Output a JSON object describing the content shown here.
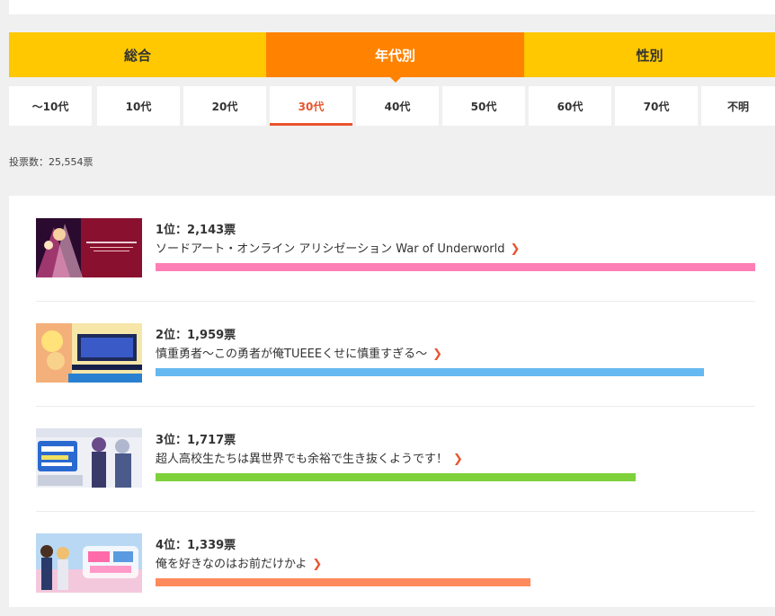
{
  "main_tabs": [
    {
      "label": "総合",
      "active": false
    },
    {
      "label": "年代別",
      "active": true
    },
    {
      "label": "性別",
      "active": false
    }
  ],
  "age_tabs": [
    {
      "label": "〜10代",
      "active": false
    },
    {
      "label": "10代",
      "active": false
    },
    {
      "label": "20代",
      "active": false
    },
    {
      "label": "30代",
      "active": true
    },
    {
      "label": "40代",
      "active": false
    },
    {
      "label": "50代",
      "active": false
    },
    {
      "label": "60代",
      "active": false
    },
    {
      "label": "70代",
      "active": false
    },
    {
      "label": "不明",
      "active": false
    }
  ],
  "vote_count": "投票数：25,554票",
  "ranking": [
    {
      "rank_label": "1位：2,143票",
      "title": "ソードアート・オンライン アリシゼーション War of Underworld",
      "votes": 2143,
      "bar_color": "#ff7eb6"
    },
    {
      "rank_label": "2位：1,959票",
      "title": "慎重勇者〜この勇者が俺TUEEEくせに慎重すぎる〜",
      "votes": 1959,
      "bar_color": "#66b8f0"
    },
    {
      "rank_label": "3位：1,717票",
      "title": "超人高校生たちは異世界でも余裕で生き抜くようです！",
      "votes": 1717,
      "bar_color": "#7ed13a"
    },
    {
      "rank_label": "4位：1,339票",
      "title": "俺を好きなのはお前だけかよ",
      "votes": 1339,
      "bar_color": "#ff8a5c"
    }
  ],
  "icons": {
    "link_chevron": "chevron-right-icon"
  }
}
